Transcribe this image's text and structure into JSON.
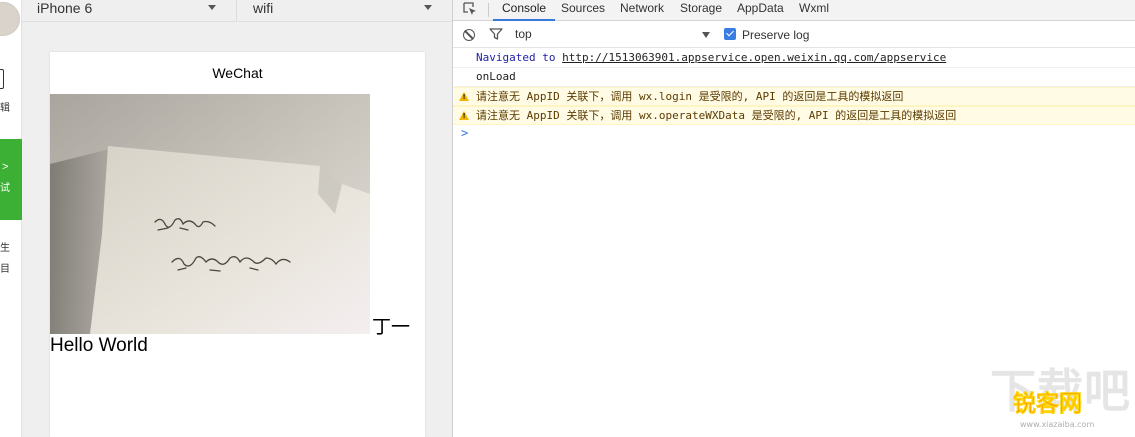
{
  "left_strip": {
    "edit_label_fragment": "辑",
    "debug_arrow": ">",
    "debug_label_fragment": "试",
    "project_label_fragment_1": "生",
    "project_label_fragment_2": "目"
  },
  "simulator": {
    "device": "iPhone 6",
    "network": "wifi",
    "nav_title": "WeChat",
    "inline_text": "丁一",
    "hello_text": "Hello World"
  },
  "devtools": {
    "tabs": [
      {
        "label": "Console",
        "active": true
      },
      {
        "label": "Sources",
        "active": false
      },
      {
        "label": "Network",
        "active": false
      },
      {
        "label": "Storage",
        "active": false
      },
      {
        "label": "AppData",
        "active": false
      },
      {
        "label": "Wxml",
        "active": false
      }
    ],
    "context": "top",
    "preserve_log_label": "Preserve log",
    "preserve_log_checked": true,
    "prompt_symbol": ">",
    "messages": {
      "navigated_prefix": "Navigated to ",
      "navigated_url": "http://1513063901.appservice.open.weixin.qq.com/appservice",
      "onload": "onLoad",
      "warn1": "请注意无 AppID 关联下，调用 wx.login 是受限的, API 的返回是工具的模拟返回",
      "warn2": "请注意无 AppID 关联下，调用 wx.operateWXData 是受限的, API 的返回是工具的模拟返回"
    }
  },
  "watermark": {
    "big_text": "下载吧",
    "logo_text": "锐客网",
    "url_text": "www.xiazaiba.com"
  },
  "colors": {
    "accent_green": "#3cb035",
    "tab_active_blue": "#3879d9",
    "warning_bg": "#fffbe5"
  }
}
